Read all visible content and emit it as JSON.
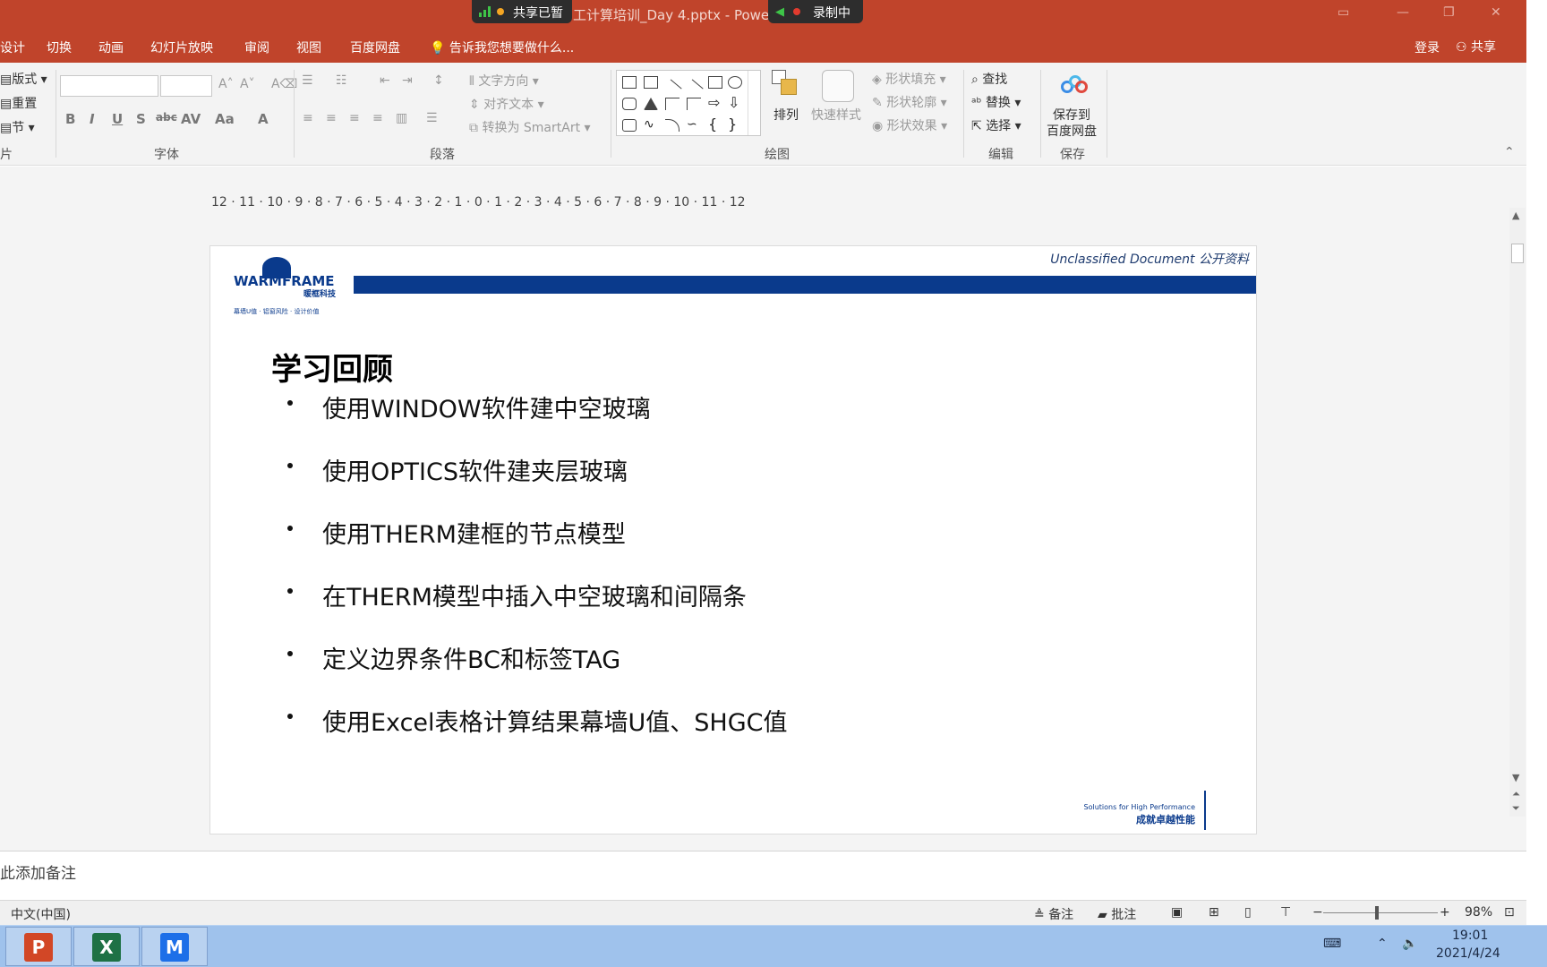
{
  "titlebar": {
    "title": "工计算培训_Day 4.pptx - PowerPoint",
    "share_status": "共享已暂",
    "recording": "录制中"
  },
  "tabs": [
    "设计",
    "切换",
    "动画",
    "幻灯片放映",
    "审阅",
    "视图",
    "百度网盘"
  ],
  "tell_me": "告诉我您想要做什么...",
  "account": {
    "login": "登录",
    "share": "共享"
  },
  "ribbon": {
    "slides_group": {
      "layout": "版式",
      "reset": "重置",
      "section": "节",
      "label": "片"
    },
    "font_group": {
      "label": "字体"
    },
    "paragraph_group": {
      "label": "段落",
      "text_direction": "文字方向",
      "align_text": "对齐文本",
      "smartart": "转换为 SmartArt"
    },
    "drawing_group": {
      "label": "绘图",
      "arrange": "排列",
      "quick_styles": "快速样式",
      "shape_fill": "形状填充",
      "shape_outline": "形状轮廓",
      "shape_effects": "形状效果"
    },
    "editing_group": {
      "label": "编辑",
      "find": "查找",
      "replace": "替换",
      "select": "选择"
    },
    "save_group": {
      "label": "保存",
      "save_line1": "保存到",
      "save_line2": "百度网盘"
    }
  },
  "ruler": "12 · 11 · 10 · 9 · 8 · 7 · 6 · 5 · 4 · 3 · 2 · 1 · 0 · 1 · 2 · 3 · 4 · 5 · 6 · 7 · 8 · 9 · 10 · 11 · 12",
  "slide": {
    "header_note": "Unclassified Document 公开资料",
    "logo": {
      "name": "WARMFRAME",
      "cn": "暖框科技",
      "tagline": "幕墙U值 · 铝窗风险 · 设计价值"
    },
    "title": "学习回顾",
    "bullets": [
      "使用WINDOW软件建中空玻璃",
      "使用OPTICS软件建夹层玻璃",
      "使用THERM建框的节点模型",
      "在THERM模型中插入中空玻璃和间隔条",
      "定义边界条件BC和标签TAG",
      "使用Excel表格计算结果幕墙U值、SHGC值"
    ],
    "footer_en": "Solutions for High Performance",
    "footer_cn": "成就卓越性能"
  },
  "notes": {
    "placeholder": "此添加备注"
  },
  "statusbar": {
    "language": "中文(中国)",
    "notes_btn": "备注",
    "comments_btn": "批注",
    "zoom": "98%",
    "zoom_level": 0.47
  },
  "taskbar": {
    "apps": [
      {
        "name": "powerpoint",
        "label": "P",
        "color": "#d24726"
      },
      {
        "name": "excel",
        "label": "X",
        "color": "#1e7145"
      },
      {
        "name": "tencent-meeting",
        "label": "M",
        "color": "#1d6fe8"
      }
    ],
    "time": "19:01",
    "date": "2021/4/24"
  }
}
